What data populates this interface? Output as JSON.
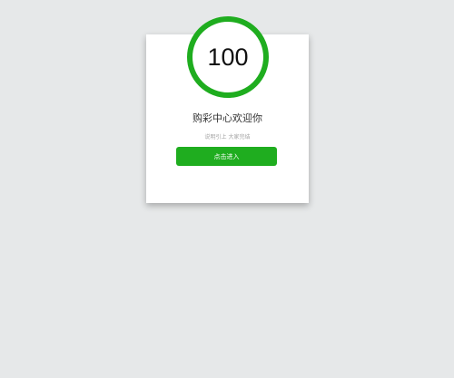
{
  "score": {
    "value": "100",
    "ring_color": "#1fad1f"
  },
  "welcome": {
    "title": "购彩中心欢迎你",
    "subtitle": "说明引上 大家完结"
  },
  "enter_button": {
    "label": "点击进入",
    "color": "#1fad1f"
  }
}
